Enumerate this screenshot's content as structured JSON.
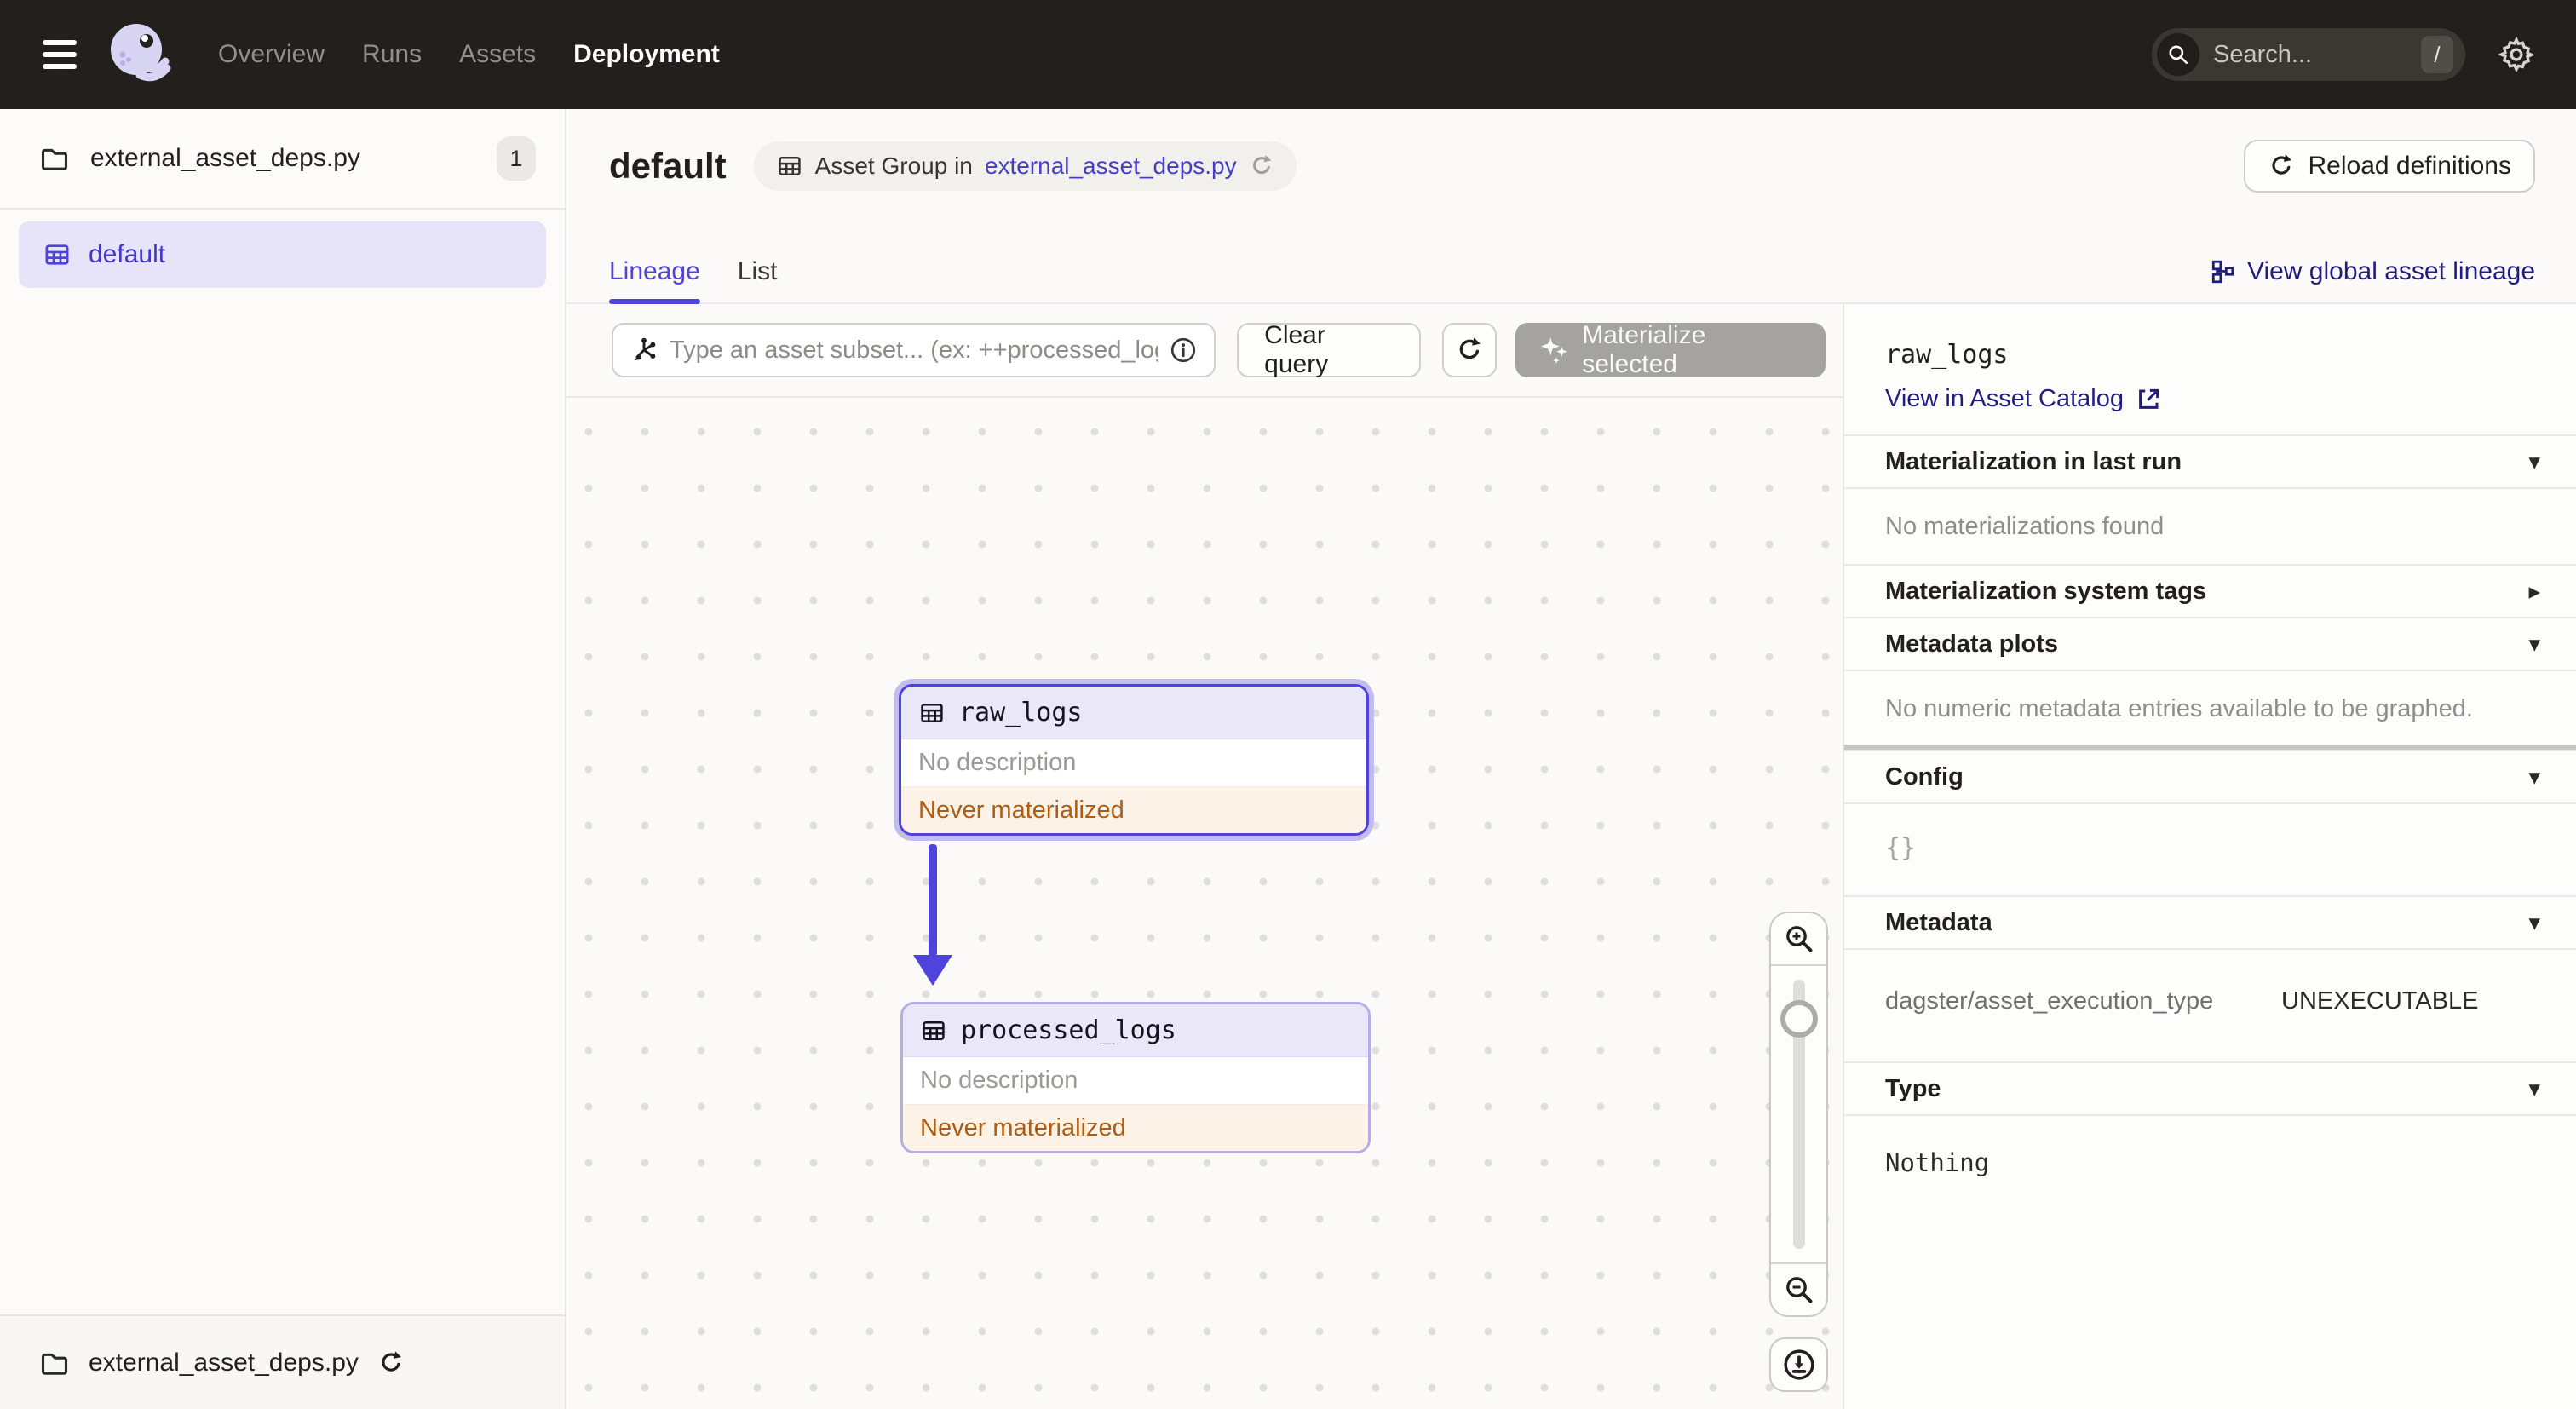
{
  "colors": {
    "accent": "#4F43DD",
    "navy_link": "#211C80",
    "breadcrumb_link": "#453EC4",
    "warning_text": "#B05C10",
    "warning_bg": "#FCF2E7",
    "selection_bg": "#E7E4F9",
    "nav_bg": "#221F1D"
  },
  "icons": {
    "caret_down": "▾",
    "caret_right": "▸",
    "gear": "⚙"
  },
  "topnav": {
    "menu": {
      "items": [
        {
          "label": "Overview"
        },
        {
          "label": "Runs"
        },
        {
          "label": "Assets"
        },
        {
          "label": "Deployment"
        }
      ]
    },
    "search": {
      "placeholder": "Search...",
      "shortcut": "/"
    }
  },
  "sidebar": {
    "file": {
      "label": "external_asset_deps.py",
      "count": "1"
    },
    "group": {
      "label": "default"
    },
    "footer": {
      "label": "external_asset_deps.py"
    }
  },
  "header": {
    "title": "default",
    "breadcrumb": {
      "prefix": "Asset Group in",
      "link": "external_asset_deps.py"
    },
    "reload_label": "Reload definitions"
  },
  "tabs": {
    "items": [
      {
        "label": "Lineage"
      },
      {
        "label": "List"
      }
    ],
    "global_lineage_label": "View global asset lineage"
  },
  "toolbar": {
    "query_placeholder": "Type an asset subset... (ex: ++processed_logs",
    "clear_label": "Clear query",
    "materialize_label": "Materialize selected"
  },
  "graph": {
    "nodes": [
      {
        "name": "raw_logs",
        "description": "No description",
        "status": "Never materialized"
      },
      {
        "name": "processed_logs",
        "description": "No description",
        "status": "Never materialized"
      }
    ]
  },
  "panel": {
    "title": "raw_logs",
    "catalog_link": "View in Asset Catalog",
    "sections": {
      "last_run": {
        "label": "Materialization in last run",
        "body": "No materializations found"
      },
      "system_tags": {
        "label": "Materialization system tags"
      },
      "metadata_plots": {
        "label": "Metadata plots",
        "body": "No numeric metadata entries available to be graphed."
      },
      "config": {
        "label": "Config",
        "body": "{}"
      },
      "metadata": {
        "label": "Metadata",
        "rows": [
          {
            "key": "dagster/asset_execution_type",
            "value": "UNEXECUTABLE"
          }
        ]
      },
      "type": {
        "label": "Type",
        "body": "Nothing"
      }
    }
  }
}
